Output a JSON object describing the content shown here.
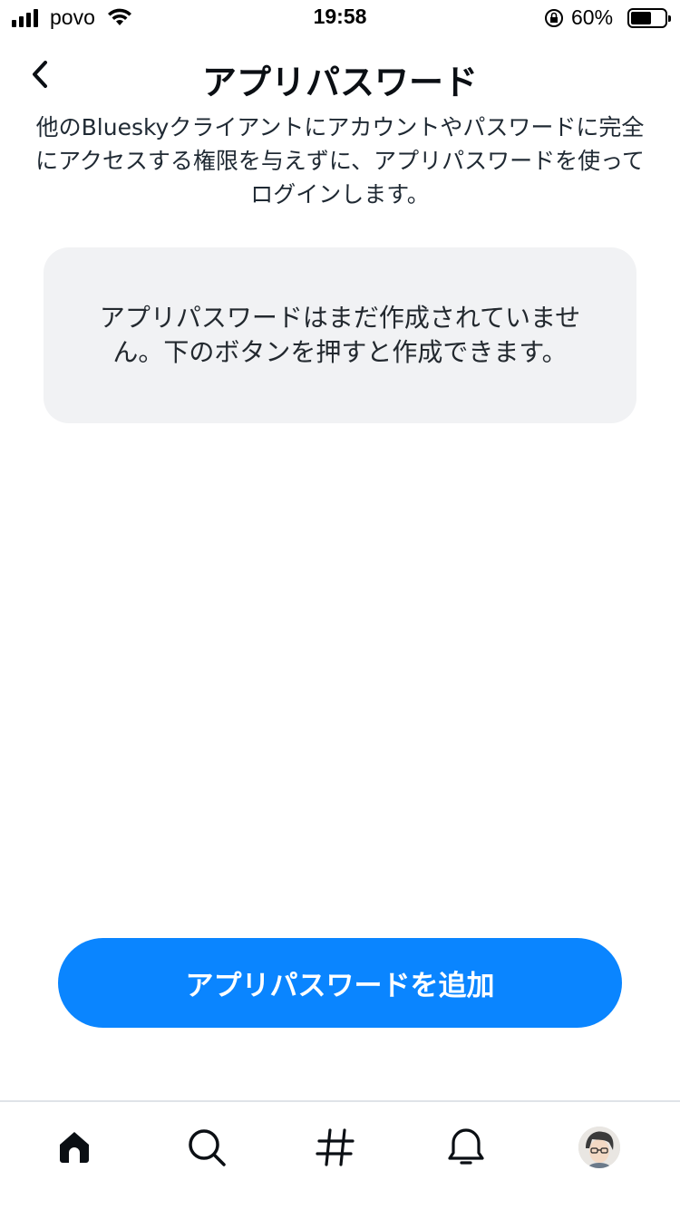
{
  "status_bar": {
    "carrier": "povo",
    "time": "19:58",
    "battery_percent": "60%",
    "battery_level": 0.6
  },
  "header": {
    "title": "アプリパスワード",
    "back_icon": "chevron-left-icon"
  },
  "description": "他のBlueskyクライアントにアカウントやパスワードに完全にアクセスする権限を与えずに、アプリパスワードを使ってログインします。",
  "empty_state": {
    "message": "アプリパスワードはまだ作成されていません。下のボタンを押すと作成できます。"
  },
  "add_button": {
    "label": "アプリパスワードを追加"
  },
  "tab_bar": {
    "items": [
      {
        "name": "home",
        "icon": "home-icon"
      },
      {
        "name": "search",
        "icon": "search-icon"
      },
      {
        "name": "feeds",
        "icon": "hashtag-icon"
      },
      {
        "name": "notifications",
        "icon": "bell-icon"
      },
      {
        "name": "profile",
        "icon": "avatar"
      }
    ]
  },
  "colors": {
    "accent": "#0a85ff",
    "card_bg": "#f1f2f4",
    "text": "#0b0f14"
  }
}
